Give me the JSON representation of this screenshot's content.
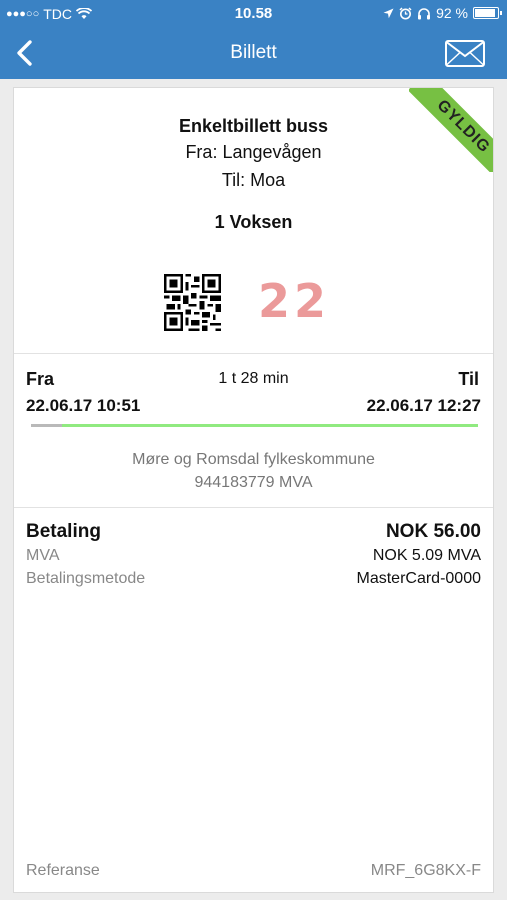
{
  "status_bar": {
    "signal": "●●●○○",
    "carrier": "TDC",
    "time": "10.58",
    "battery_text": "92 %",
    "battery_level": 0.92
  },
  "navbar": {
    "title": "Billett",
    "back_icon": "chevron-left-icon",
    "mail_icon": "envelope-icon"
  },
  "ticket": {
    "badge": "GYLDIG",
    "badge_color": "#77c043",
    "title": "Enkeltbillett buss",
    "from": "Fra: Langevågen",
    "to": "Til: Moa",
    "passengers": "1 Voksen",
    "code": "22",
    "code_color": "#eb9a9a"
  },
  "journey": {
    "from_label": "Fra",
    "to_label": "Til",
    "duration": "1 t 28 min",
    "departure": "22.06.17 10:51",
    "arrival": "22.06.17 12:27",
    "progress": 0.07,
    "progress_color": "#90ea80"
  },
  "issuer": {
    "name": "Møre og Romsdal fylkeskommune",
    "org_nr": "944183779 MVA"
  },
  "payment": {
    "label": "Betaling",
    "amount": "NOK 56.00",
    "mva_label": "MVA",
    "mva_value": "NOK 5.09 MVA",
    "method_label": "Betalingsmetode",
    "method_value": "MasterCard-0000"
  },
  "reference": {
    "label": "Referanse",
    "value": "MRF_6G8KX-F"
  },
  "accent_color": "#3a82c4"
}
